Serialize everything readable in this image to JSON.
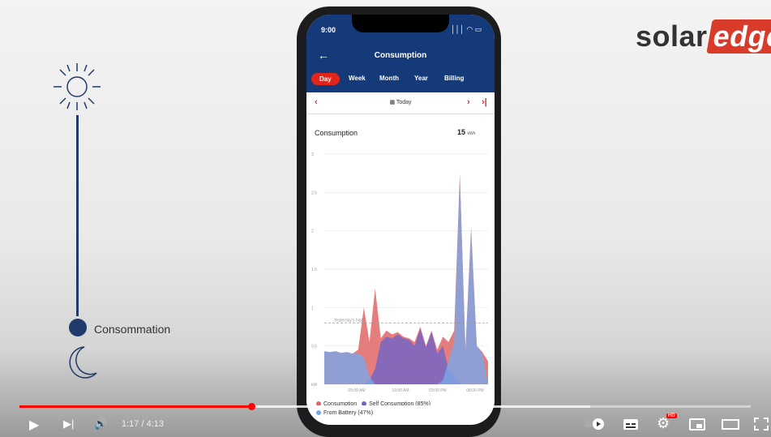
{
  "brand": {
    "logo_part1": "solar",
    "logo_part2": "edge",
    "accent": "#d93b2b"
  },
  "timeline": {
    "label": "Consommation",
    "color": "#1f3a6b"
  },
  "phone": {
    "status_time": "9:00",
    "status_icons": "│││ ◠ ▭",
    "header": {
      "back_icon": "←",
      "title": "Consumption"
    },
    "tabs": [
      {
        "label": "Day",
        "active": true
      },
      {
        "label": "Week"
      },
      {
        "label": "Month"
      },
      {
        "label": "Year"
      },
      {
        "label": "Billing"
      }
    ],
    "date_nav": {
      "prev": "‹",
      "label": "Today",
      "next": "›",
      "last": "›|"
    },
    "card": {
      "title": "Consumption",
      "total_value": "15",
      "total_unit": "kWh"
    },
    "legend": [
      {
        "label": "Consumption",
        "color": "#e06666"
      },
      {
        "label": "Self Consumption (85%)",
        "color": "#6f64c8"
      },
      {
        "label": "From Battery (47%)",
        "color": "#7aa7e8"
      }
    ],
    "reference_line": "Yesterday's high"
  },
  "chart_data": {
    "type": "area",
    "ylim": [
      0,
      3
    ],
    "yticks": [
      "3",
      "2.5",
      "2",
      "1.5",
      "1",
      "0.5",
      "kW"
    ],
    "xticks": [
      "05:00 AM",
      "10:00 AM",
      "03:00 PM",
      "08:00 PM"
    ],
    "reference_value": 0.8,
    "series": [
      {
        "name": "Consumption",
        "color": "#e06666",
        "values": [
          0.43,
          0.42,
          0.43,
          0.41,
          0.42,
          0.4,
          0.45,
          1.0,
          0.55,
          1.25,
          0.6,
          0.7,
          0.65,
          0.68,
          0.62,
          0.6,
          0.55,
          0.75,
          0.5,
          0.7,
          0.45,
          0.62,
          0.55,
          0.7,
          2.75,
          0.45,
          2.05,
          0.5,
          0.42,
          0.3
        ]
      },
      {
        "name": "Self Consumption (85%)",
        "color": "#6f64c8",
        "values": [
          0,
          0,
          0,
          0,
          0,
          0,
          0,
          0,
          0.05,
          0.2,
          0.55,
          0.62,
          0.6,
          0.65,
          0.6,
          0.58,
          0.5,
          0.72,
          0.48,
          0.68,
          0.4,
          0.5,
          0.2,
          0.1,
          0,
          0,
          0,
          0,
          0,
          0
        ]
      },
      {
        "name": "From Battery (47%)",
        "color": "#7aa7e8",
        "values": [
          0.43,
          0.42,
          0.43,
          0.41,
          0.42,
          0.4,
          0.4,
          0.35,
          0.1,
          0,
          0,
          0,
          0,
          0,
          0,
          0,
          0,
          0,
          0,
          0,
          0,
          0.05,
          0.3,
          0.55,
          2.7,
          0.45,
          2.0,
          0.5,
          0.4,
          0
        ]
      }
    ]
  },
  "video": {
    "current_time": "1:17",
    "duration": "4:13",
    "time_display": "1:17 / 4:13",
    "played_fraction": 0.304,
    "buffered_fraction": 0.78,
    "play_icon": "▶",
    "next_icon": "▶|",
    "volume_icon": "🔊",
    "settings_badge": "HD"
  }
}
